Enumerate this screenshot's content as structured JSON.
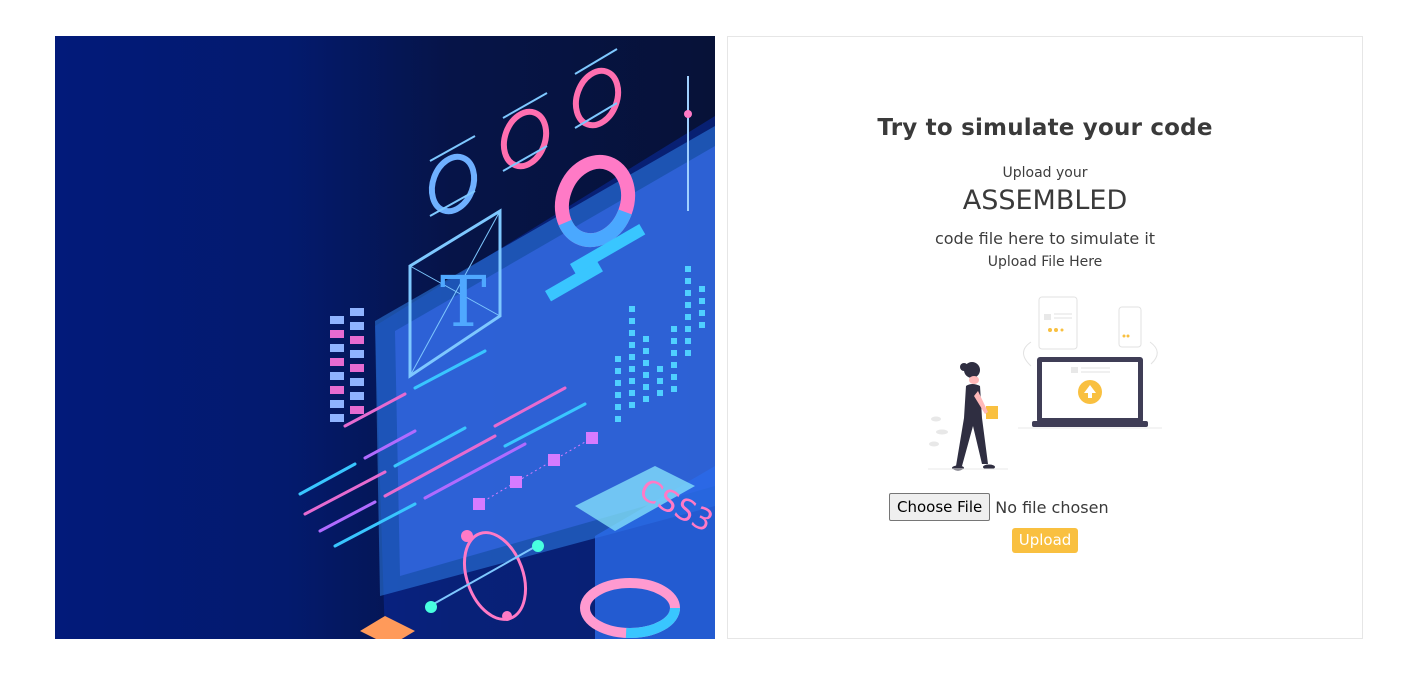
{
  "hero": {
    "image_name": "isometric-developer-dashboard-illustration",
    "badge_text": "CSS3",
    "glyph_text": "T"
  },
  "panel": {
    "title": "Try to simulate your code",
    "upload_your": "Upload your",
    "assembled": "ASSEMBLED",
    "code_file_text": "code file here to simulate it",
    "upload_file_here": "Upload File Here",
    "illustration_name": "file-upload-illustration",
    "file_input": {
      "button_label": "Choose File",
      "status_text": "No file chosen"
    },
    "upload_button_label": "Upload"
  },
  "colors": {
    "accent": "#f9c040",
    "hero_bg": "#021a7a",
    "text": "#3a3a3a"
  }
}
